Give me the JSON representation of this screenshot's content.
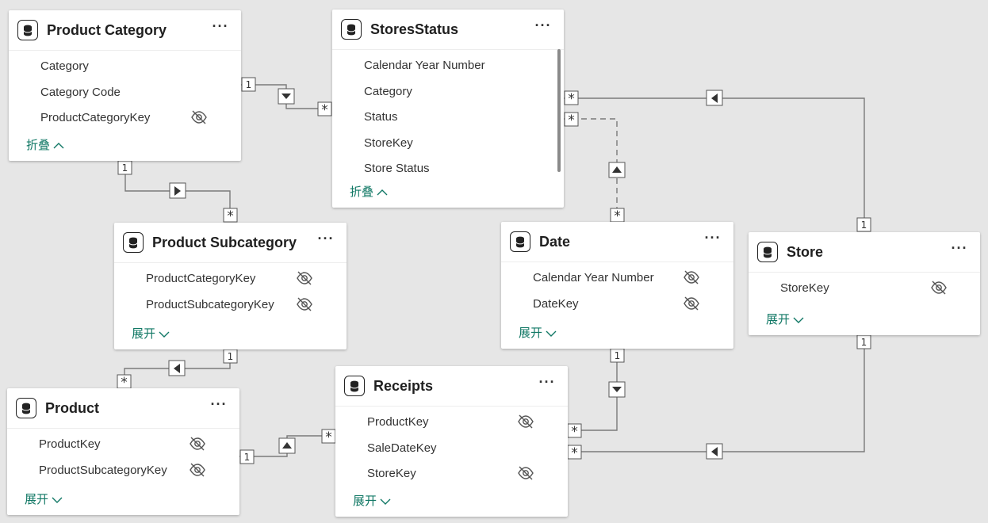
{
  "tables": {
    "product_category": {
      "title": "Product Category",
      "fields": [
        "Category",
        "Category Code",
        "ProductCategoryKey"
      ],
      "toggle": "折叠"
    },
    "stores_status": {
      "title": "StoresStatus",
      "fields": [
        "Calendar Year Number",
        "Category",
        "Status",
        "StoreKey",
        "Store Status"
      ],
      "toggle": "折叠"
    },
    "product_subcategory": {
      "title": "Product Subcategory",
      "fields": [
        "ProductCategoryKey",
        "ProductSubcategoryKey"
      ],
      "toggle": "展开"
    },
    "date": {
      "title": "Date",
      "fields": [
        "Calendar Year Number",
        "DateKey"
      ],
      "toggle": "展开"
    },
    "store": {
      "title": "Store",
      "fields": [
        "StoreKey"
      ],
      "toggle": "展开"
    },
    "product": {
      "title": "Product",
      "fields": [
        "ProductKey",
        "ProductSubcategoryKey"
      ],
      "toggle": "展开"
    },
    "receipts": {
      "title": "Receipts",
      "fields": [
        "ProductKey",
        "SaleDateKey",
        "StoreKey"
      ],
      "toggle": "展开"
    }
  },
  "common": {
    "more": "···",
    "one": "1",
    "many": "*"
  },
  "colors": {
    "canvas": "#e6e6e6",
    "line": "#7a7a7a",
    "link": "#117865"
  }
}
